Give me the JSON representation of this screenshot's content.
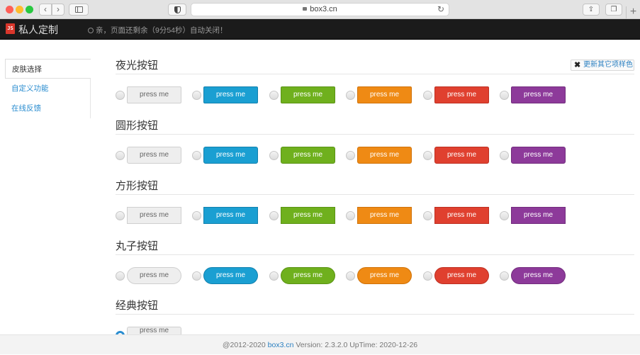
{
  "browser": {
    "url": "box3.cn"
  },
  "app": {
    "logo_text": "JS",
    "title": "私人定制",
    "notice": "亲，页面还剩余（9分54秒）自动关闭！"
  },
  "sidebar": {
    "items": [
      {
        "label": "皮肤选择"
      },
      {
        "label": "自定义功能"
      },
      {
        "label": "在线反馈"
      }
    ]
  },
  "update_button": {
    "label": "更新其它项样色"
  },
  "sections": [
    {
      "title": "夜光按钮"
    },
    {
      "title": "圆形按钮"
    },
    {
      "title": "方形按钮"
    },
    {
      "title": "丸子按钮"
    },
    {
      "title": "经典按钮"
    }
  ],
  "button_label": "press me",
  "button_colors": [
    {
      "name": "white",
      "bg": "#eeeeee",
      "border": "#cfcfcf"
    },
    {
      "name": "blue",
      "bg": "#1a9fd2",
      "border": "#1281ae"
    },
    {
      "name": "green",
      "bg": "#6fb01d",
      "border": "#5a9314"
    },
    {
      "name": "orange",
      "bg": "#ef8a14",
      "border": "#cf720a"
    },
    {
      "name": "red",
      "bg": "#e0402f",
      "border": "#bd2f21"
    },
    {
      "name": "purple",
      "bg": "#8d3a9a",
      "border": "#722c7d"
    }
  ],
  "footer": {
    "prefix": "@2012-2020 ",
    "brand": "box3.cn",
    "suffix": " Version: 2.3.2.0 UpTime: 2020-12-26"
  }
}
